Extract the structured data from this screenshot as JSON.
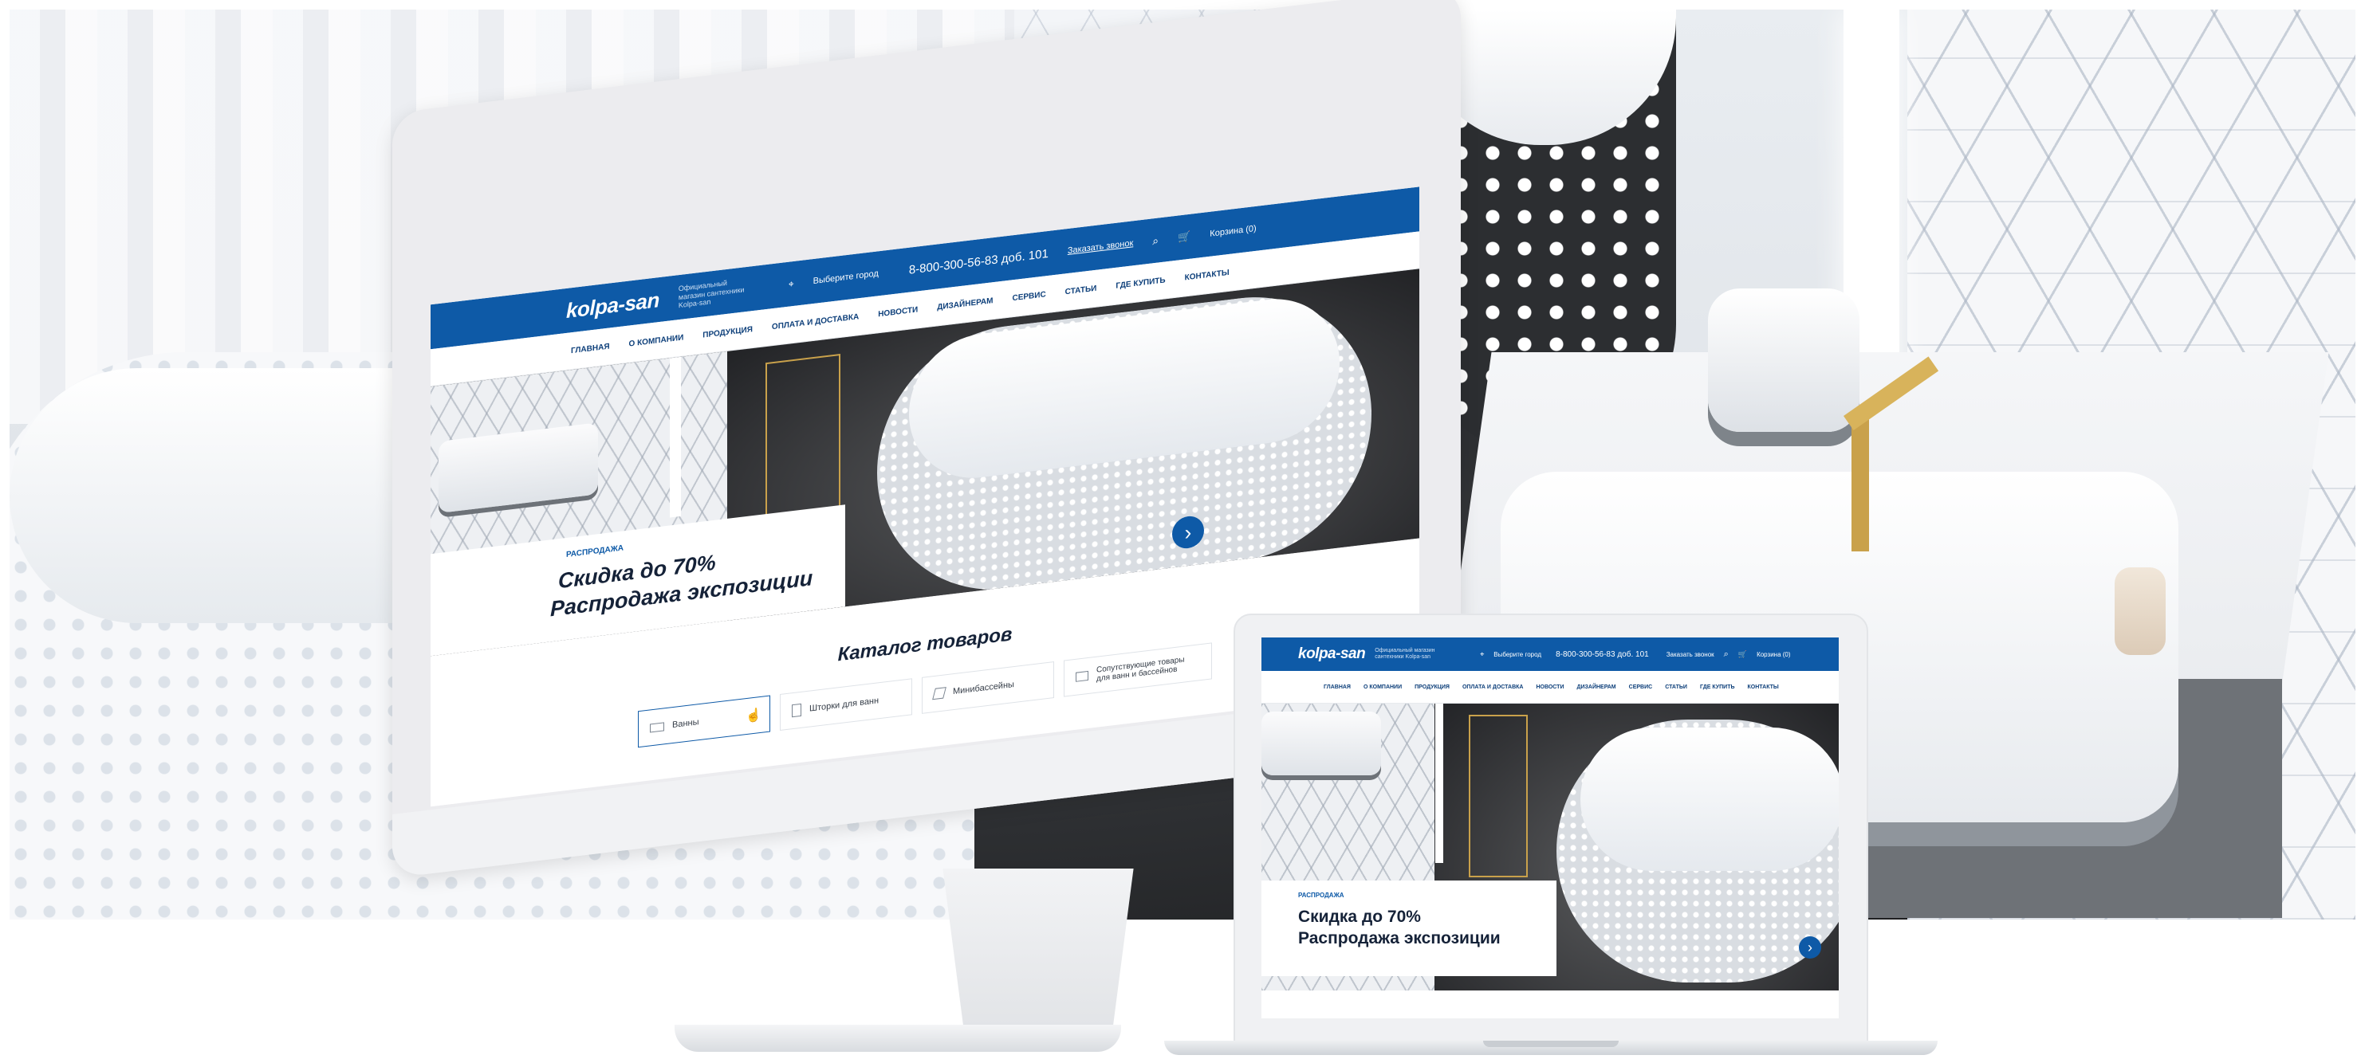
{
  "site": {
    "logo": "kolpa-san",
    "tagline": "Официальный магазин сантехники Kolpa-san",
    "city": "Выберите город",
    "phone": "8-800-300-56-83 доб. 101",
    "callback": "Заказать звонок",
    "cart": "Корзина (0)",
    "menu": [
      "ГЛАВНАЯ",
      "О КОМПАНИИ",
      "ПРОДУКЦИЯ",
      "ОПЛАТА И ДОСТАВКА",
      "НОВОСТИ",
      "ДИЗАЙНЕРАМ",
      "СЕРВИС",
      "СТАТЬИ",
      "ГДЕ КУПИТЬ",
      "КОНТАКТЫ"
    ],
    "hero": {
      "kicker": "РАСПРОДАЖА",
      "title_line1": "Скидка до 70%",
      "title_line2": "Распродажа экспозиции",
      "next_glyph": "›"
    },
    "catalog": {
      "title": "Каталог товаров",
      "items": [
        "Ванны",
        "Шторки для ванн",
        "Минибассейны",
        "Сопутствующие товары для ванн и бассейнов"
      ]
    }
  },
  "icons": {
    "location": "location-pin-icon",
    "search": "search-icon",
    "cart": "cart-icon",
    "cursor": "hand-cursor-icon"
  },
  "colors": {
    "brand_blue": "#0e5aa7",
    "navy_text": "#0d3f7a",
    "title_text": "#152238"
  }
}
